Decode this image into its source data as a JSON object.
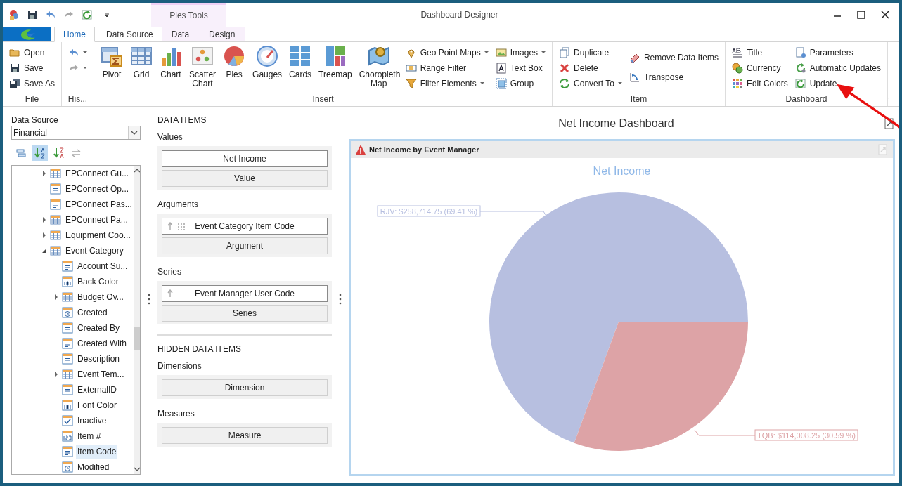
{
  "window": {
    "title": "Dashboard Designer"
  },
  "ribbon": {
    "contextual_header": "Pies Tools",
    "tabs": [
      {
        "label": "Home",
        "selected": true,
        "contextual": false
      },
      {
        "label": "Data Source",
        "selected": false,
        "contextual": false
      },
      {
        "label": "Data",
        "selected": false,
        "contextual": true
      },
      {
        "label": "Design",
        "selected": false,
        "contextual": true
      }
    ],
    "groups": [
      {
        "label": "File",
        "columns": [
          [
            {
              "label": "Open",
              "kind": "small"
            },
            {
              "label": "Save",
              "kind": "small"
            },
            {
              "label": "Save As",
              "kind": "small"
            }
          ]
        ]
      },
      {
        "label": "His...",
        "columns": [
          [
            {
              "kind": "small",
              "dropdown": true
            },
            {
              "kind": "small",
              "dropdown": true
            }
          ]
        ]
      },
      {
        "label": "Insert",
        "columns": [
          [
            {
              "label": "Pivot",
              "kind": "large"
            }
          ],
          [
            {
              "label": "Grid",
              "kind": "large"
            }
          ],
          [
            {
              "label": "Chart",
              "kind": "large"
            }
          ],
          [
            {
              "label": "Scatter Chart",
              "kind": "large"
            }
          ],
          [
            {
              "label": "Pies",
              "kind": "large"
            }
          ],
          [
            {
              "label": "Gauges",
              "kind": "large"
            }
          ],
          [
            {
              "label": "Cards",
              "kind": "large"
            }
          ],
          [
            {
              "label": "Treemap",
              "kind": "large"
            }
          ],
          [
            {
              "label": "Choropleth Map",
              "kind": "large"
            }
          ],
          [
            {
              "label": "Geo Point Maps",
              "kind": "small",
              "dropdown": true
            },
            {
              "label": "Range Filter",
              "kind": "small"
            },
            {
              "label": "Filter Elements",
              "kind": "small",
              "dropdown": true
            }
          ],
          [
            {
              "label": "Images",
              "kind": "small",
              "dropdown": true
            },
            {
              "label": "Text Box",
              "kind": "small"
            },
            {
              "label": "Group",
              "kind": "small"
            }
          ]
        ]
      },
      {
        "label": "Item",
        "columns": [
          [
            {
              "label": "Duplicate",
              "kind": "small"
            },
            {
              "label": "Delete",
              "kind": "small"
            },
            {
              "label": "Convert To",
              "kind": "small",
              "dropdown": true
            }
          ],
          [
            {
              "label": "Remove Data Items",
              "kind": "medium"
            },
            {
              "label": "Transpose",
              "kind": "medium"
            }
          ]
        ]
      },
      {
        "label": "Dashboard",
        "columns": [
          [
            {
              "label": "Title",
              "kind": "small"
            },
            {
              "label": "Currency",
              "kind": "small"
            },
            {
              "label": "Edit Colors",
              "kind": "small"
            }
          ],
          [
            {
              "label": "Parameters",
              "kind": "small"
            },
            {
              "label": "Automatic Updates",
              "kind": "small"
            },
            {
              "label": "Update",
              "kind": "small"
            }
          ]
        ]
      }
    ]
  },
  "data_source": {
    "label": "Data Source",
    "value": "Financial",
    "tree": [
      {
        "label": "EPConnect Gu...",
        "kind": "table",
        "expanded": false,
        "selected": false
      },
      {
        "label": "EPConnect Op...",
        "kind": "text",
        "selected": false
      },
      {
        "label": "EPConnect Pas...",
        "kind": "text",
        "selected": false
      },
      {
        "label": "EPConnect Pa...",
        "kind": "table",
        "expanded": false,
        "selected": false
      },
      {
        "label": "Equipment Coo...",
        "kind": "table",
        "expanded": false,
        "selected": false
      },
      {
        "label": "Event Category",
        "kind": "table",
        "expanded": true,
        "selected": false,
        "children": [
          {
            "label": "Account Su...",
            "kind": "text",
            "selected": false
          },
          {
            "label": "Back Color",
            "kind": "number",
            "selected": false
          },
          {
            "label": "Budget Ov...",
            "kind": "table",
            "expanded": false,
            "selected": false
          },
          {
            "label": "Created",
            "kind": "date",
            "selected": false
          },
          {
            "label": "Created By",
            "kind": "text",
            "selected": false
          },
          {
            "label": "Created With",
            "kind": "text",
            "selected": false
          },
          {
            "label": "Description",
            "kind": "text",
            "selected": false
          },
          {
            "label": "Event Tem...",
            "kind": "table",
            "expanded": false,
            "selected": false
          },
          {
            "label": "ExternalID",
            "kind": "text",
            "selected": false
          },
          {
            "label": "Font Color",
            "kind": "number",
            "selected": false
          },
          {
            "label": "Inactive",
            "kind": "bool",
            "selected": false
          },
          {
            "label": "Item #",
            "kind": "integer",
            "selected": false
          },
          {
            "label": "Item Code",
            "kind": "text",
            "selected": true
          },
          {
            "label": "Modified",
            "kind": "date",
            "selected": false
          }
        ]
      }
    ]
  },
  "data_items": {
    "heading": "DATA ITEMS",
    "sections": [
      {
        "label": "Values",
        "items": [
          {
            "label": "Net Income",
            "kind": "measure"
          },
          {
            "label": "Value",
            "kind": "placeholder"
          }
        ]
      },
      {
        "label": "Arguments",
        "items": [
          {
            "label": "Event Category Item Code",
            "kind": "argument"
          },
          {
            "label": "Argument",
            "kind": "placeholder"
          }
        ]
      },
      {
        "label": "Series",
        "items": [
          {
            "label": "Event Manager User Code",
            "kind": "series"
          },
          {
            "label": "Series",
            "kind": "placeholder"
          }
        ]
      }
    ]
  },
  "hidden_data_items": {
    "heading": "HIDDEN DATA ITEMS",
    "sections": [
      {
        "label": "Dimensions",
        "items": [
          {
            "label": "Dimension",
            "kind": "placeholder"
          }
        ]
      },
      {
        "label": "Measures",
        "items": [
          {
            "label": "Measure",
            "kind": "placeholder"
          }
        ]
      }
    ]
  },
  "dashboard": {
    "title": "Net Income Dashboard",
    "item": {
      "caption": "Net Income by Event Manager",
      "chart_data": {
        "type": "pie",
        "title": "Net Income",
        "series": [
          {
            "colors": [
              "#b7bfe0",
              "#dda3a6"
            ],
            "values": [
              69.41,
              30.59
            ]
          }
        ],
        "value_labels": [
          "RJV: $258,714.75 (69.41 %)",
          "TQB: $114,008.25 (30.59 %)"
        ]
      }
    }
  }
}
